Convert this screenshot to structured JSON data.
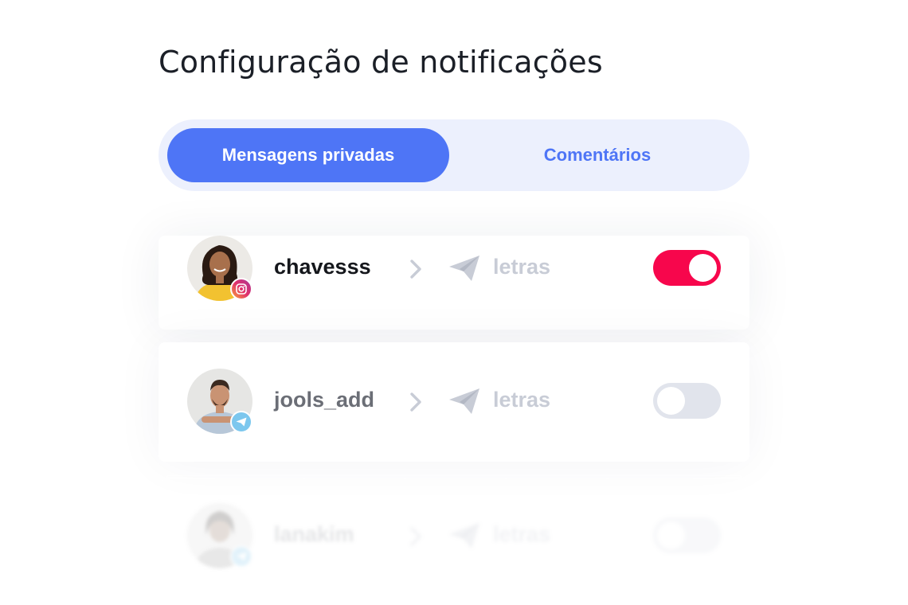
{
  "page": {
    "title": "Configuração de notificações"
  },
  "tabs": [
    {
      "label": "Mensagens privadas",
      "active": true
    },
    {
      "label": "Comentários",
      "active": false
    }
  ],
  "accounts": [
    {
      "username": "chavesss",
      "platform": "instagram",
      "target": "letras",
      "enabled": true
    },
    {
      "username": "jools_add",
      "platform": "telegram",
      "target": "letras",
      "enabled": false
    },
    {
      "username": "lanakim",
      "platform": "telegram",
      "target": "letras",
      "enabled": false
    }
  ],
  "colors": {
    "accent": "#4e75f6",
    "tab_background": "#ecf0fd",
    "toggle_on": "#f7064c",
    "toggle_off": "#e1e4ec",
    "muted_text": "#c8ccd6"
  },
  "icons": {
    "arrow": "chevron-right-icon",
    "destination": "paper-plane-icon",
    "instagram_badge": "instagram-icon",
    "telegram_badge": "telegram-icon"
  }
}
